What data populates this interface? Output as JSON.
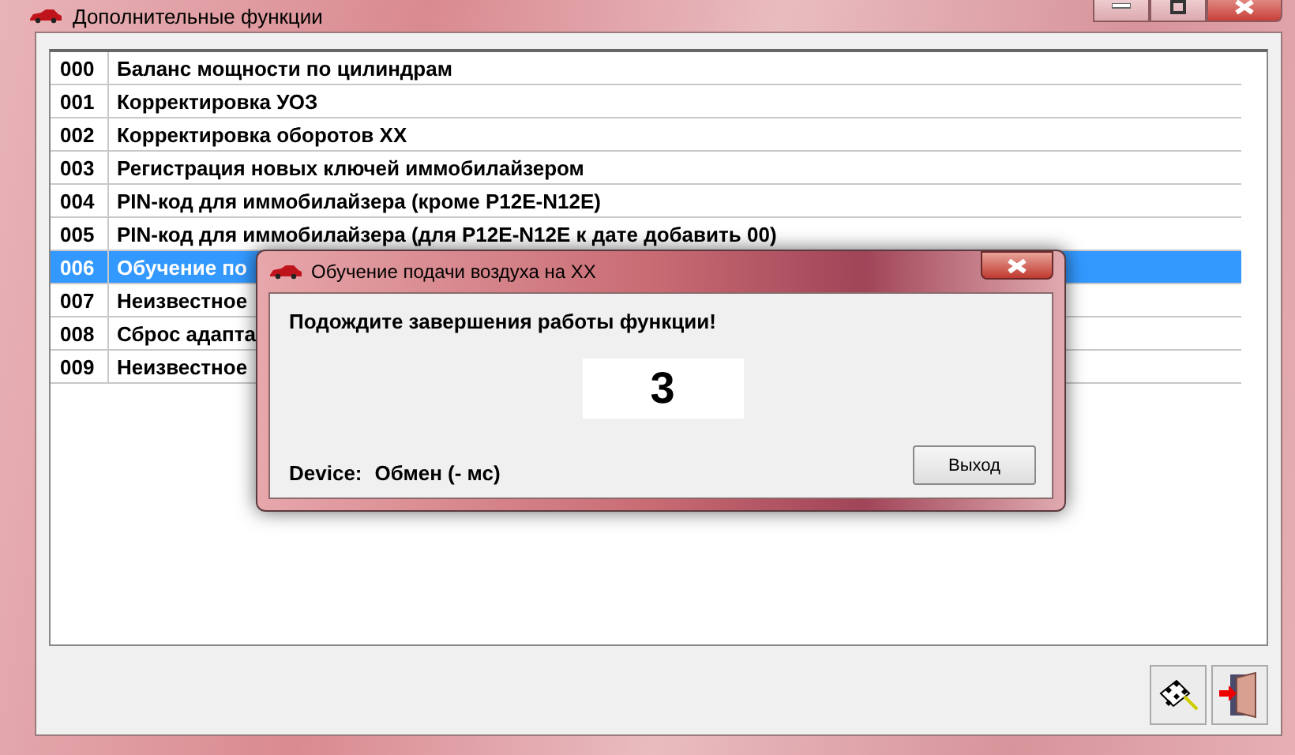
{
  "window": {
    "title": "Дополнительные функции"
  },
  "functions": [
    {
      "code": "000",
      "name": "Баланс мощности по цилиндрам",
      "selected": false
    },
    {
      "code": "001",
      "name": "Корректировка УОЗ",
      "selected": false
    },
    {
      "code": "002",
      "name": "Корректировка оборотов XX",
      "selected": false
    },
    {
      "code": "003",
      "name": "Регистрация новых ключей иммобилайзером",
      "selected": false
    },
    {
      "code": "004",
      "name": "PIN-код для иммобилайзера (кроме P12E-N12E)",
      "selected": false
    },
    {
      "code": "005",
      "name": "PIN-код для иммобилайзера (для P12E-N12E к дате добавить 00)",
      "selected": false
    },
    {
      "code": "006",
      "name": "Обучение по",
      "selected": true
    },
    {
      "code": "007",
      "name": "Неизвестное",
      "selected": false
    },
    {
      "code": "008",
      "name": "Сброс адапта",
      "selected": false
    },
    {
      "code": "009",
      "name": "Неизвестное",
      "selected": false
    }
  ],
  "toolbar": [
    {
      "kind": "flag"
    },
    {
      "kind": "exit"
    }
  ],
  "dialog": {
    "title": "Обучение подачи воздуха на XX",
    "message": "Подождите завершения работы функции!",
    "counter": "3",
    "status_label": "Device:",
    "status_value": "Обмен (- мс)",
    "buttons": [
      "Выход"
    ]
  }
}
